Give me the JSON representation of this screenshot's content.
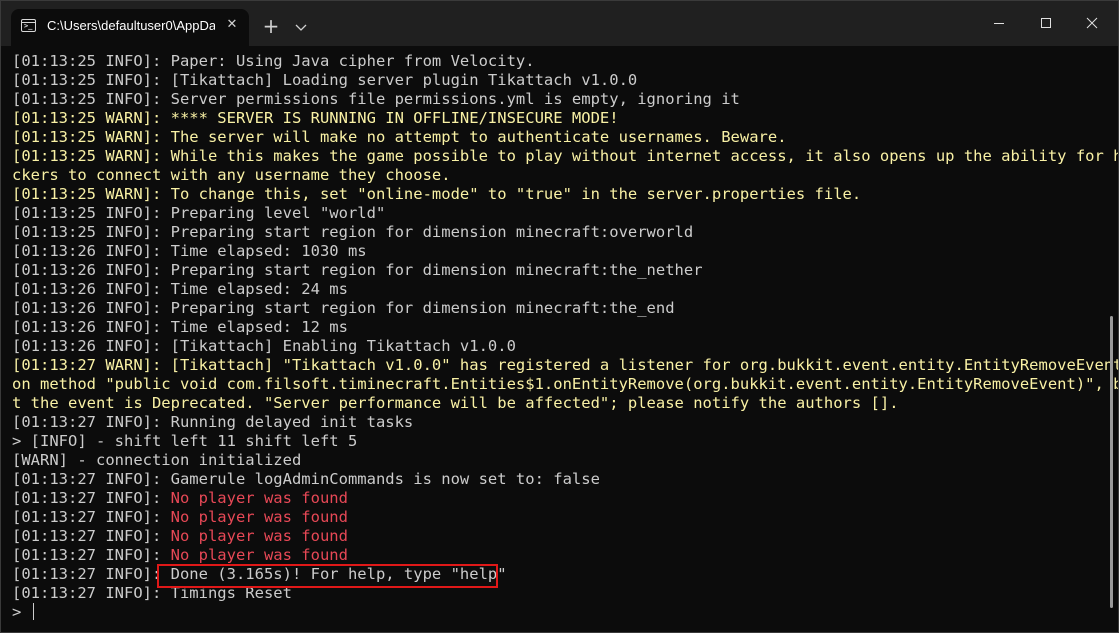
{
  "window": {
    "tab_title": "C:\\Users\\defaultuser0\\AppDa",
    "tab_close_glyph": "✕",
    "new_tab_glyph": "+",
    "icons": {
      "tab": "terminal-icon",
      "dropdown": "chevron-down-icon",
      "minimize": "minimize-icon",
      "maximize": "maximize-icon",
      "close": "close-icon"
    }
  },
  "colors": {
    "info": "#cccccc",
    "warn": "#f9f1a5",
    "error": "#e74856",
    "highlight_border": "#e01818"
  },
  "console": {
    "lines": [
      {
        "text": "[01:13:25 INFO]: Paper: Using Java cipher from Velocity.",
        "level": "info"
      },
      {
        "text": "[01:13:25 INFO]: [Tikattach] Loading server plugin Tikattach v1.0.0",
        "level": "info"
      },
      {
        "text": "[01:13:25 INFO]: Server permissions file permissions.yml is empty, ignoring it",
        "level": "info"
      },
      {
        "text": "[01:13:25 WARN]: **** SERVER IS RUNNING IN OFFLINE/INSECURE MODE!",
        "level": "warn"
      },
      {
        "text": "[01:13:25 WARN]: The server will make no attempt to authenticate usernames. Beware.",
        "level": "warn"
      },
      {
        "text": "[01:13:25 WARN]: While this makes the game possible to play without internet access, it also opens up the ability for ha",
        "level": "warn"
      },
      {
        "text": "ckers to connect with any username they choose.",
        "level": "warn"
      },
      {
        "text": "[01:13:25 WARN]: To change this, set \"online-mode\" to \"true\" in the server.properties file.",
        "level": "warn"
      },
      {
        "text": "[01:13:25 INFO]: Preparing level \"world\"",
        "level": "info"
      },
      {
        "text": "[01:13:25 INFO]: Preparing start region for dimension minecraft:overworld",
        "level": "info"
      },
      {
        "text": "[01:13:26 INFO]: Time elapsed: 1030 ms",
        "level": "info"
      },
      {
        "text": "[01:13:26 INFO]: Preparing start region for dimension minecraft:the_nether",
        "level": "info"
      },
      {
        "text": "[01:13:26 INFO]: Time elapsed: 24 ms",
        "level": "info"
      },
      {
        "text": "[01:13:26 INFO]: Preparing start region for dimension minecraft:the_end",
        "level": "info"
      },
      {
        "text": "[01:13:26 INFO]: Time elapsed: 12 ms",
        "level": "info"
      },
      {
        "text": "[01:13:26 INFO]: [Tikattach] Enabling Tikattach v1.0.0",
        "level": "info"
      },
      {
        "text": "[01:13:27 WARN]: [Tikattach] \"Tikattach v1.0.0\" has registered a listener for org.bukkit.event.entity.EntityRemoveEvent",
        "level": "warn"
      },
      {
        "text": "on method \"public void com.filsoft.timinecraft.Entities$1.onEntityRemove(org.bukkit.event.entity.EntityRemoveEvent)\", bu",
        "level": "warn"
      },
      {
        "text": "t the event is Deprecated. \"Server performance will be affected\"; please notify the authors [].",
        "level": "warn"
      },
      {
        "text": "[01:13:27 INFO]: Running delayed init tasks",
        "level": "info"
      },
      {
        "text": "> [INFO] - shift left 11 shift left 5",
        "level": "info"
      },
      {
        "text": "[WARN] - connection initialized",
        "level": "info"
      },
      {
        "text": "[01:13:27 INFO]: Gamerule logAdminCommands is now set to: false",
        "level": "info"
      },
      {
        "prefix": "[01:13:27 INFO]: ",
        "text": "No player was found",
        "level": "error"
      },
      {
        "prefix": "[01:13:27 INFO]: ",
        "text": "No player was found",
        "level": "error"
      },
      {
        "prefix": "[01:13:27 INFO]: ",
        "text": "No player was found",
        "level": "error"
      },
      {
        "prefix": "[01:13:27 INFO]: ",
        "text": "No player was found",
        "level": "error"
      },
      {
        "text": "[01:13:27 INFO]: Done (3.165s)! For help, type \"help\"",
        "level": "info",
        "highlighted": true
      },
      {
        "text": "[01:13:27 INFO]: Timings Reset",
        "level": "info"
      }
    ],
    "prompt": "> "
  }
}
